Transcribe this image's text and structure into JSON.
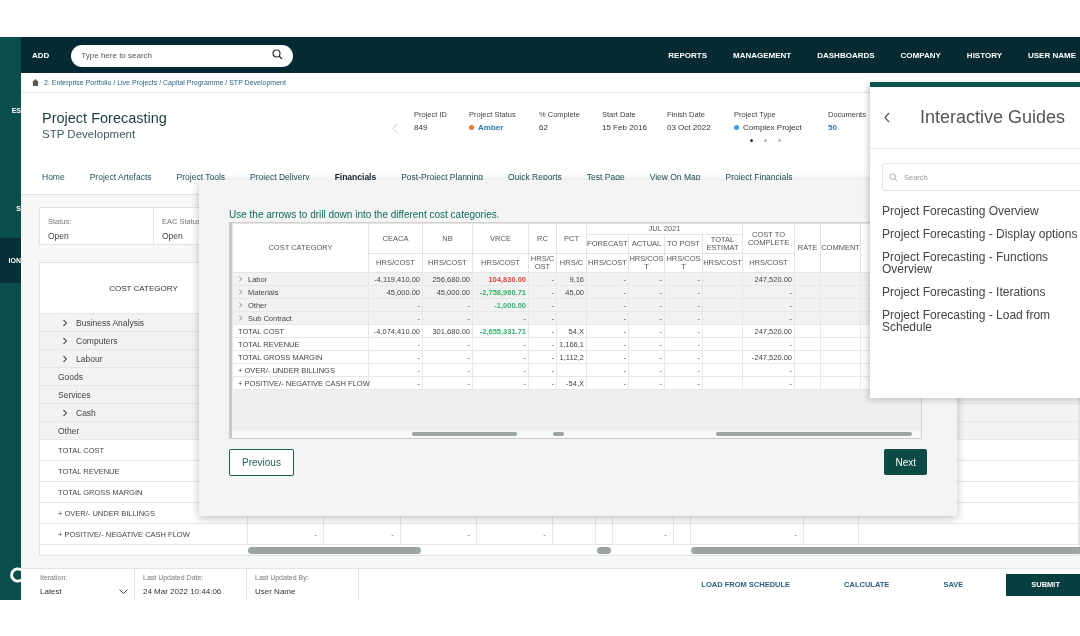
{
  "sidebar": {
    "items": [
      {
        "label": "ES",
        "selected": false
      },
      {
        "label": "S",
        "selected": false
      },
      {
        "label": "ION",
        "selected": true
      }
    ]
  },
  "topbar": {
    "add": "ADD",
    "search": {
      "placeholder": "Type here to search"
    },
    "nav": [
      "REPORTS",
      "MANAGEMENT",
      "DASHBOARDS",
      "COMPANY",
      "HISTORY",
      "USER NAME"
    ]
  },
  "breadcrumb": "2. Enterprise Portfolio / Live Projects / Capital Programme / STP Development",
  "project": {
    "title": "Project Forecasting",
    "subtitle": "STP Development",
    "fields": [
      {
        "label": "Project ID",
        "value": "849",
        "link": false
      },
      {
        "label": "Project Status",
        "value": "Amber",
        "link": true,
        "color": "#e8772e"
      },
      {
        "label": "% Complete",
        "value": "62",
        "link": false
      },
      {
        "label": "Start Date",
        "value": "15 Feb 2016",
        "link": false
      },
      {
        "label": "Finish Date",
        "value": "03 Oct 2022",
        "link": false
      },
      {
        "label": "Project Type",
        "value": "Complex Project",
        "link": false,
        "color": "#3aa0e0"
      },
      {
        "label": "Documents",
        "value": "50",
        "link": true
      }
    ]
  },
  "pager": [
    {
      "selected": true
    },
    {
      "selected": false
    },
    {
      "selected": false
    }
  ],
  "tabs": [
    {
      "label": "Home",
      "selected": false
    },
    {
      "label": "Project Artefacts",
      "selected": false
    },
    {
      "label": "Project Tools",
      "selected": false
    },
    {
      "label": "Project Delivery",
      "selected": false
    },
    {
      "label": "Financials",
      "selected": true
    },
    {
      "label": "Post-Project Planning",
      "selected": false
    },
    {
      "label": "Quick Reports",
      "selected": false
    },
    {
      "label": "Test Page",
      "selected": false
    },
    {
      "label": "View On Map",
      "selected": false
    },
    {
      "label": "Project Financials",
      "selected": false
    }
  ],
  "status_box": [
    {
      "label": "Status:",
      "value": "Open"
    },
    {
      "label": "EAC Status",
      "value": "Open"
    }
  ],
  "table": {
    "header": "COST CATEGORY",
    "rows": [
      {
        "label": "Business Analysis",
        "kind": "category",
        "expandable": true
      },
      {
        "label": "Computers",
        "kind": "category",
        "expandable": true
      },
      {
        "label": "Labour",
        "kind": "category",
        "expandable": true
      },
      {
        "label": "Goods",
        "kind": "category",
        "expandable": false
      },
      {
        "label": "Services",
        "kind": "category",
        "expandable": false
      },
      {
        "label": "Cash",
        "kind": "category",
        "expandable": true
      },
      {
        "label": "Other",
        "kind": "category",
        "expandable": false
      },
      {
        "label": "TOTAL COST",
        "kind": "total",
        "expandable": false
      },
      {
        "label": "TOTAL REVENUE",
        "kind": "total",
        "expandable": false
      },
      {
        "label": "TOTAL GROSS MARGIN",
        "kind": "total",
        "expandable": false
      },
      {
        "label": "+ OVER/- UNDER BILLINGS",
        "kind": "total",
        "expandable": false
      },
      {
        "label": "+ POSITIVE/- NEGATIVE CASH FLOW",
        "kind": "total",
        "expandable": false,
        "cells": [
          "-",
          "-",
          "-",
          "-",
          "-",
          "-"
        ]
      }
    ]
  },
  "guide_step": {
    "instruction": "Use the arrows to drill down into the different cost categories.",
    "screenshot": {
      "category_header": "COST CATEGORY",
      "columns": [
        "CEACA",
        "NB",
        "VRCE",
        "RC",
        "PCT"
      ],
      "period": "JUL 2021",
      "period_columns": [
        "FORECAST",
        "ACTUAL",
        "TO POST",
        "TOTAL ESTIMAT"
      ],
      "ctc_header": "COST TO COMPLETE",
      "tail_columns": [
        "RATE",
        "COMMENT"
      ],
      "units": [
        "HRS/COST",
        "HRS/COST",
        "HRS/COST",
        "HRS/COST",
        "HRS/C",
        "HRS/COST",
        "HRS/COST",
        "HRS/COST",
        "HRS/COST",
        "HRS/COST"
      ],
      "rows": [
        {
          "label": "Labor",
          "expandable": true,
          "cells": [
            "-4,119,410.00",
            "256,680.00",
            {
              "text": "104,830.00",
              "color": "#e0463c"
            },
            "-",
            "9,16",
            "-",
            "-",
            "-",
            "247,520.00"
          ]
        },
        {
          "label": "Materials",
          "expandable": true,
          "cells": [
            "45,000.00",
            "45,000.00",
            {
              "text": "-2,758,960.71",
              "color": "#2fb36a"
            },
            "-",
            "45,00",
            "-",
            "-",
            "-",
            "-"
          ]
        },
        {
          "label": "Other",
          "expandable": true,
          "cells": [
            "-",
            "-",
            {
              "text": "-1,000.00",
              "color": "#2fb36a"
            },
            "-",
            null,
            "-",
            "-",
            "-",
            "-"
          ]
        },
        {
          "label": "Sub Contract",
          "expandable": true,
          "cells": [
            "-",
            "-",
            "-",
            "-",
            null,
            "-",
            "-",
            "-",
            "-"
          ]
        },
        {
          "label": "TOTAL COST",
          "expandable": false,
          "cells": [
            "-4,074,410.00",
            "301,680.00",
            {
              "text": "-2,655,331.71",
              "color": "#2fb36a"
            },
            "-",
            "54,X",
            "-",
            "-",
            "-",
            "247,520.00"
          ]
        },
        {
          "label": "TOTAL REVENUE",
          "expandable": false,
          "cells": [
            "-",
            "-",
            "-",
            "-",
            "1,166,1",
            "-",
            "-",
            "-",
            "-"
          ]
        },
        {
          "label": "TOTAL GROSS MARGIN",
          "expandable": false,
          "cells": [
            "-",
            "-",
            "-",
            "-",
            "1,112,2",
            "-",
            "-",
            "-",
            "-247,520.00"
          ]
        },
        {
          "label": "+ OVER/- UNDER BILLINGS",
          "expandable": false,
          "cells": [
            "-",
            "-",
            "-",
            "-",
            null,
            "-",
            "-",
            "-",
            "-"
          ]
        },
        {
          "label": "+ POSITIVE/- NEGATIVE CASH FLOW",
          "expandable": false,
          "cells": [
            "-",
            "-",
            "-",
            "-",
            "-54,X",
            "-",
            "-",
            "-",
            "-"
          ]
        }
      ]
    },
    "previous": "Previous",
    "next": "Next"
  },
  "guides_panel": {
    "title": "Interactive Guides",
    "search": {
      "placeholder": "Search"
    },
    "items": [
      "Project Forecasting Overview",
      "Project Forecasting - Display options",
      "Project Forecasting - Functions Overview",
      "Project Forecasting - Iterations",
      "Project Forecasting - Load from Schedule"
    ]
  },
  "footer": {
    "fields": [
      {
        "label": "Iteration:",
        "value": "Latest",
        "kind": "select"
      },
      {
        "label": "Last Updated Date:",
        "value": "24 Mar 2022 10:44:06",
        "kind": "text"
      },
      {
        "label": "Last Updated By:",
        "value": "User Name",
        "kind": "text"
      }
    ],
    "actions": [
      {
        "label": "LOAD FROM SCHEDULE",
        "kind": "link"
      },
      {
        "label": "CALCULATE",
        "kind": "link"
      },
      {
        "label": "SAVE",
        "kind": "link"
      },
      {
        "label": "SUBMIT",
        "kind": "primary"
      }
    ]
  }
}
